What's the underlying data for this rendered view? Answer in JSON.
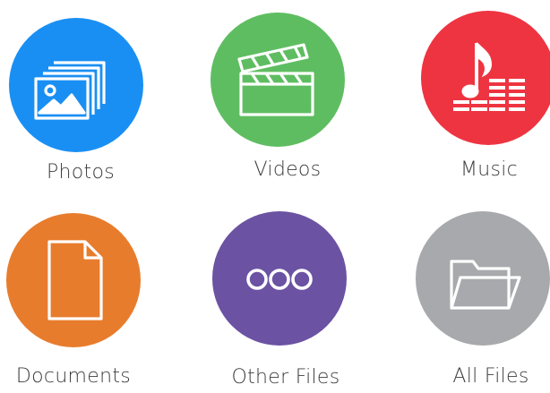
{
  "tiles": [
    {
      "key": "photos",
      "label": "Photos",
      "color": "#1a8ff3",
      "icon": "photos-icon"
    },
    {
      "key": "videos",
      "label": "Videos",
      "color": "#5fbd61",
      "icon": "clapperboard-icon"
    },
    {
      "key": "music",
      "label": "Music",
      "color": "#ee3441",
      "icon": "music-note-icon"
    },
    {
      "key": "documents",
      "label": "Documents",
      "color": "#e87c2d",
      "icon": "document-icon"
    },
    {
      "key": "other",
      "label": "Other Files",
      "color": "#6b52a3",
      "icon": "more-dots-icon"
    },
    {
      "key": "all",
      "label": "All Files",
      "color": "#a7a9ac",
      "icon": "folder-icon"
    }
  ]
}
